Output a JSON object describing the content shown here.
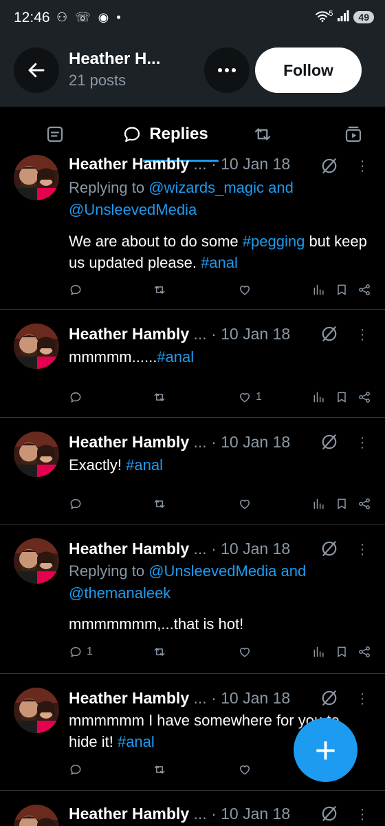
{
  "status_bar": {
    "time": "12:46",
    "signal_badge": "5",
    "battery": "49"
  },
  "header": {
    "name": "Heather H...",
    "posts_count": "21 posts",
    "follow_label": "Follow",
    "back_icon": "back-arrow-icon",
    "more_icon": "more-icon"
  },
  "tabs": [
    {
      "icon": "posts-icon"
    },
    {
      "icon": "reply-bubble-icon",
      "label": "Replies",
      "active": true
    },
    {
      "icon": "repost-icon"
    },
    {
      "icon": "media-icon"
    }
  ],
  "posts": [
    {
      "author": "Heather Hambly",
      "ellipsis": "...",
      "date": "· 10 Jan 18",
      "replying_prefix": "Replying to",
      "replying_to_1": "@wizards_magic",
      "replying_and": "and",
      "replying_to_2": "@UnsleevedMedia",
      "text": "We are about to do some",
      "hashtag_1": "#pegging",
      "text_2": "but keep us updated please.",
      "hashtag_2": "#anal",
      "replies": "",
      "likes": ""
    },
    {
      "author": "Heather Hambly",
      "ellipsis": "...",
      "date": "· 10 Jan 18",
      "text": "mmmmm......",
      "hashtag": "#anal",
      "replies": "",
      "likes": "1"
    },
    {
      "author": "Heather Hambly",
      "ellipsis": "...",
      "date": "· 10 Jan 18",
      "text": "Exactly!",
      "hashtag": "#anal",
      "replies": "",
      "likes": ""
    },
    {
      "author": "Heather Hambly",
      "ellipsis": "...",
      "date": "· 10 Jan 18",
      "replying_prefix": "Replying to",
      "replying_to_1": "@UnsleevedMedia",
      "replying_and": "and",
      "replying_to_2": "@themanaleek",
      "text": "mmmmmmm,...that is hot!",
      "replies": "1",
      "likes": ""
    },
    {
      "author": "Heather Hambly",
      "ellipsis": "...",
      "date": "· 10 Jan 18",
      "text": "mmmmmm I have somewhere for you to hide it!",
      "hashtag": "#anal",
      "replies": "",
      "likes": ""
    },
    {
      "author": "Heather Hambly",
      "ellipsis": "...",
      "date": "· 10 Jan 18"
    }
  ],
  "fab": {
    "label": "+"
  },
  "colors": {
    "accent": "#1d9bf0",
    "background": "#000000",
    "header_bg": "#1d2226",
    "muted": "#8b98a5"
  }
}
